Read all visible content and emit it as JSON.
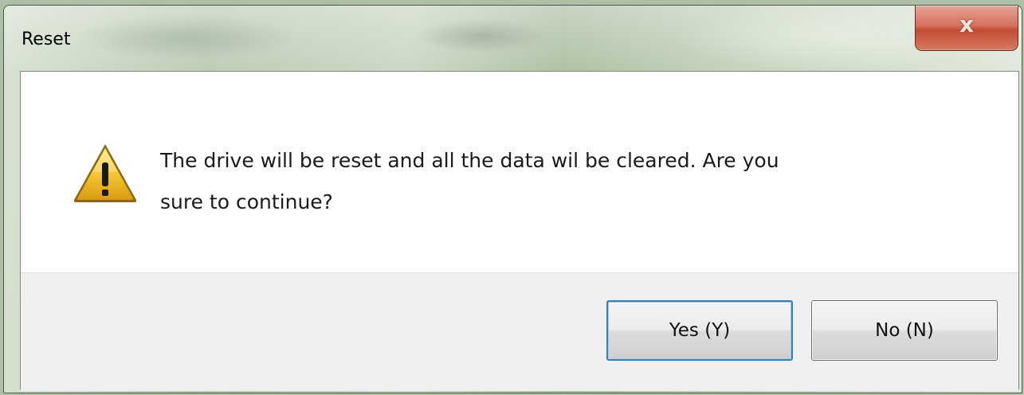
{
  "window": {
    "title": "Reset",
    "close_glyph": "x"
  },
  "dialog": {
    "icon": "warning-icon",
    "message": "The drive will be reset and all the data wil be cleared. Are you\nsure to continue?"
  },
  "buttons": {
    "yes_label": "Yes (Y)",
    "no_label": "No (N)"
  },
  "colors": {
    "warning_fill": "#f2c230",
    "close_button": "#c24b35",
    "focus_border": "#3c7fb1"
  }
}
